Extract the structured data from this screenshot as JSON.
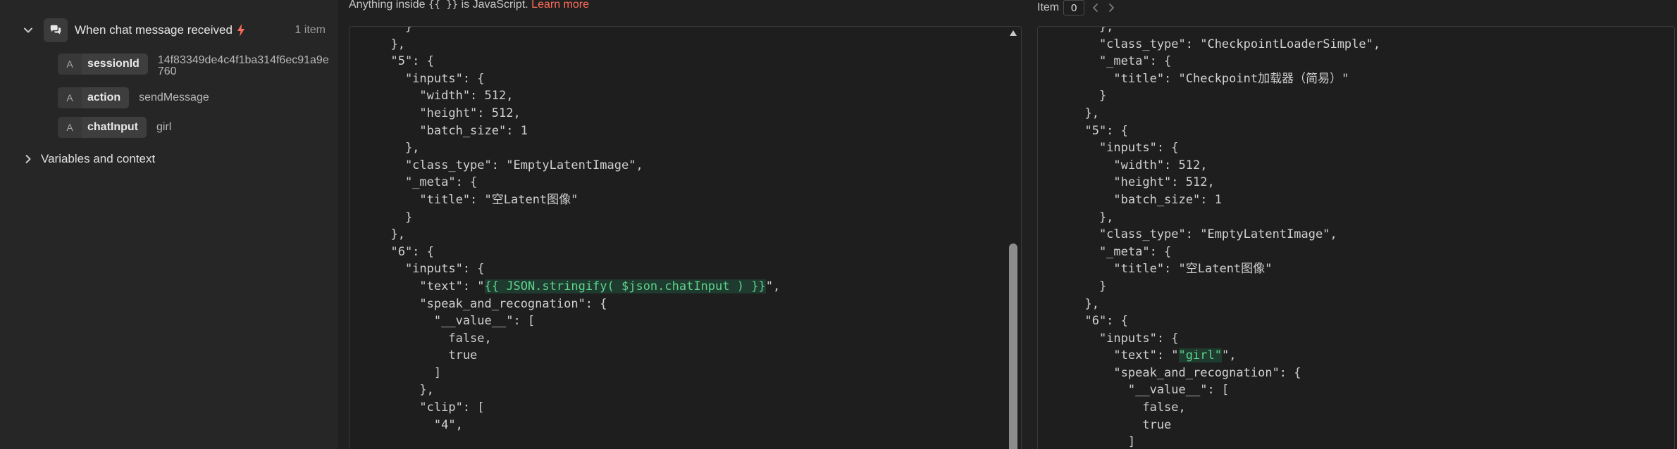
{
  "node": {
    "title": "When chat message received",
    "item_count": "1 item",
    "fields": [
      {
        "type": "A",
        "name": "sessionId",
        "value": "14f83349de4c4f1ba314f6ec91a9e760"
      },
      {
        "type": "A",
        "name": "action",
        "value": "sendMessage"
      },
      {
        "type": "A",
        "name": "chatInput",
        "value": "girl"
      }
    ],
    "variables_label": "Variables and context"
  },
  "editor": {
    "note_prefix": "Anything inside",
    "note_code": "{{ }}",
    "note_suffix": "is JavaScript.",
    "learn_more": "Learn more",
    "lines": [
      "    }",
      "  },",
      "  \"5\": {",
      "    \"inputs\": {",
      "      \"width\": 512,",
      "      \"height\": 512,",
      "      \"batch_size\": 1",
      "    },",
      "    \"class_type\": \"EmptyLatentImage\",",
      "    \"_meta\": {",
      "      \"title\": \"空Latent图像\"",
      "    }",
      "  },",
      "  \"6\": {",
      "    \"inputs\": {",
      "      \"text\": \"{{ JSON.stringify( $json.chatInput ) }}\",",
      "      \"speak_and_recognation\": {",
      "        \"__value__\": [",
      "          false,",
      "          true",
      "        ]",
      "      },",
      "      \"clip\": [",
      "        \"4\","
    ],
    "expression": "{{ JSON.stringify( $json.chatInput ) }}"
  },
  "result": {
    "item_label": "Item",
    "item_index": "0",
    "lines": [
      "    },",
      "    \"class_type\": \"CheckpointLoaderSimple\",",
      "    \"_meta\": {",
      "      \"title\": \"Checkpoint加载器（简易）\"",
      "    }",
      "  },",
      "  \"5\": {",
      "    \"inputs\": {",
      "      \"width\": 512,",
      "      \"height\": 512,",
      "      \"batch_size\": 1",
      "    },",
      "    \"class_type\": \"EmptyLatentImage\",",
      "    \"_meta\": {",
      "      \"title\": \"空Latent图像\"",
      "    }",
      "  },",
      "  \"6\": {",
      "    \"inputs\": {",
      "      \"text\": \"\"girl\"\",",
      "      \"speak_and_recognation\": {",
      "        \"__value__\": [",
      "          false,",
      "          true",
      "        ]"
    ],
    "resolved": "\"girl\""
  },
  "colors": {
    "accent": "#ff6d5a",
    "highlight_text": "#5fd38d",
    "highlight_bg": "#1f3a2e"
  },
  "icons": {
    "node": "chat-bubbles-icon",
    "trigger": "lightning-bolt-icon"
  }
}
